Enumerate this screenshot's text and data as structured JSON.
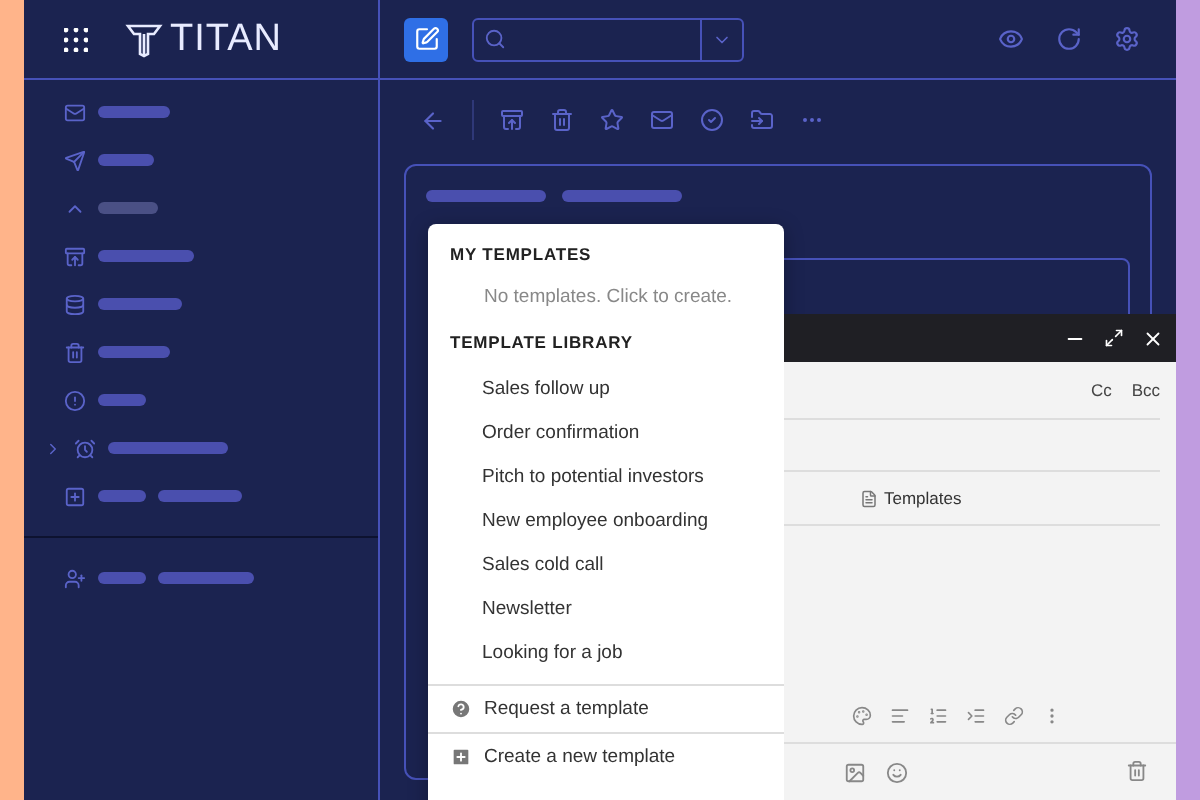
{
  "app": {
    "logo": "TITAN"
  },
  "template_menu": {
    "my_templates": {
      "heading": "MY TEMPLATES",
      "empty_text": "No templates. Click to create."
    },
    "library": {
      "heading": "TEMPLATE LIBRARY",
      "items": [
        "Sales follow up",
        "Order confirmation",
        "Pitch to potential investors",
        "New employee onboarding",
        "Sales cold call",
        "Newsletter",
        "Looking for a job"
      ]
    },
    "actions": [
      {
        "kind": "request",
        "label": "Request a template"
      },
      {
        "kind": "create",
        "label": "Create a new template"
      }
    ]
  },
  "compose": {
    "cc": "Cc",
    "bcc": "Bcc",
    "template_chip": "Templates"
  }
}
